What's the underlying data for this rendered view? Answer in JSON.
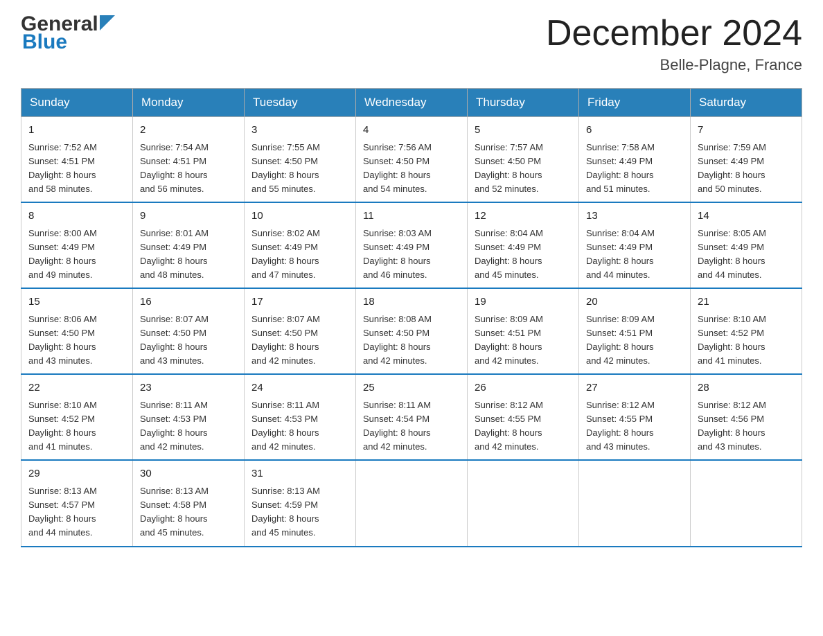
{
  "header": {
    "logo_general": "General",
    "logo_blue": "Blue",
    "month_title": "December 2024",
    "location": "Belle-Plagne, France"
  },
  "days_of_week": [
    "Sunday",
    "Monday",
    "Tuesday",
    "Wednesday",
    "Thursday",
    "Friday",
    "Saturday"
  ],
  "weeks": [
    {
      "days": [
        {
          "number": "1",
          "sunrise": "7:52 AM",
          "sunset": "4:51 PM",
          "daylight": "8 hours and 58 minutes."
        },
        {
          "number": "2",
          "sunrise": "7:54 AM",
          "sunset": "4:51 PM",
          "daylight": "8 hours and 56 minutes."
        },
        {
          "number": "3",
          "sunrise": "7:55 AM",
          "sunset": "4:50 PM",
          "daylight": "8 hours and 55 minutes."
        },
        {
          "number": "4",
          "sunrise": "7:56 AM",
          "sunset": "4:50 PM",
          "daylight": "8 hours and 54 minutes."
        },
        {
          "number": "5",
          "sunrise": "7:57 AM",
          "sunset": "4:50 PM",
          "daylight": "8 hours and 52 minutes."
        },
        {
          "number": "6",
          "sunrise": "7:58 AM",
          "sunset": "4:49 PM",
          "daylight": "8 hours and 51 minutes."
        },
        {
          "number": "7",
          "sunrise": "7:59 AM",
          "sunset": "4:49 PM",
          "daylight": "8 hours and 50 minutes."
        }
      ]
    },
    {
      "days": [
        {
          "number": "8",
          "sunrise": "8:00 AM",
          "sunset": "4:49 PM",
          "daylight": "8 hours and 49 minutes."
        },
        {
          "number": "9",
          "sunrise": "8:01 AM",
          "sunset": "4:49 PM",
          "daylight": "8 hours and 48 minutes."
        },
        {
          "number": "10",
          "sunrise": "8:02 AM",
          "sunset": "4:49 PM",
          "daylight": "8 hours and 47 minutes."
        },
        {
          "number": "11",
          "sunrise": "8:03 AM",
          "sunset": "4:49 PM",
          "daylight": "8 hours and 46 minutes."
        },
        {
          "number": "12",
          "sunrise": "8:04 AM",
          "sunset": "4:49 PM",
          "daylight": "8 hours and 45 minutes."
        },
        {
          "number": "13",
          "sunrise": "8:04 AM",
          "sunset": "4:49 PM",
          "daylight": "8 hours and 44 minutes."
        },
        {
          "number": "14",
          "sunrise": "8:05 AM",
          "sunset": "4:49 PM",
          "daylight": "8 hours and 44 minutes."
        }
      ]
    },
    {
      "days": [
        {
          "number": "15",
          "sunrise": "8:06 AM",
          "sunset": "4:50 PM",
          "daylight": "8 hours and 43 minutes."
        },
        {
          "number": "16",
          "sunrise": "8:07 AM",
          "sunset": "4:50 PM",
          "daylight": "8 hours and 43 minutes."
        },
        {
          "number": "17",
          "sunrise": "8:07 AM",
          "sunset": "4:50 PM",
          "daylight": "8 hours and 42 minutes."
        },
        {
          "number": "18",
          "sunrise": "8:08 AM",
          "sunset": "4:50 PM",
          "daylight": "8 hours and 42 minutes."
        },
        {
          "number": "19",
          "sunrise": "8:09 AM",
          "sunset": "4:51 PM",
          "daylight": "8 hours and 42 minutes."
        },
        {
          "number": "20",
          "sunrise": "8:09 AM",
          "sunset": "4:51 PM",
          "daylight": "8 hours and 42 minutes."
        },
        {
          "number": "21",
          "sunrise": "8:10 AM",
          "sunset": "4:52 PM",
          "daylight": "8 hours and 41 minutes."
        }
      ]
    },
    {
      "days": [
        {
          "number": "22",
          "sunrise": "8:10 AM",
          "sunset": "4:52 PM",
          "daylight": "8 hours and 41 minutes."
        },
        {
          "number": "23",
          "sunrise": "8:11 AM",
          "sunset": "4:53 PM",
          "daylight": "8 hours and 42 minutes."
        },
        {
          "number": "24",
          "sunrise": "8:11 AM",
          "sunset": "4:53 PM",
          "daylight": "8 hours and 42 minutes."
        },
        {
          "number": "25",
          "sunrise": "8:11 AM",
          "sunset": "4:54 PM",
          "daylight": "8 hours and 42 minutes."
        },
        {
          "number": "26",
          "sunrise": "8:12 AM",
          "sunset": "4:55 PM",
          "daylight": "8 hours and 42 minutes."
        },
        {
          "number": "27",
          "sunrise": "8:12 AM",
          "sunset": "4:55 PM",
          "daylight": "8 hours and 43 minutes."
        },
        {
          "number": "28",
          "sunrise": "8:12 AM",
          "sunset": "4:56 PM",
          "daylight": "8 hours and 43 minutes."
        }
      ]
    },
    {
      "days": [
        {
          "number": "29",
          "sunrise": "8:13 AM",
          "sunset": "4:57 PM",
          "daylight": "8 hours and 44 minutes."
        },
        {
          "number": "30",
          "sunrise": "8:13 AM",
          "sunset": "4:58 PM",
          "daylight": "8 hours and 45 minutes."
        },
        {
          "number": "31",
          "sunrise": "8:13 AM",
          "sunset": "4:59 PM",
          "daylight": "8 hours and 45 minutes."
        },
        null,
        null,
        null,
        null
      ]
    }
  ],
  "labels": {
    "sunrise": "Sunrise:",
    "sunset": "Sunset:",
    "daylight": "Daylight:"
  }
}
